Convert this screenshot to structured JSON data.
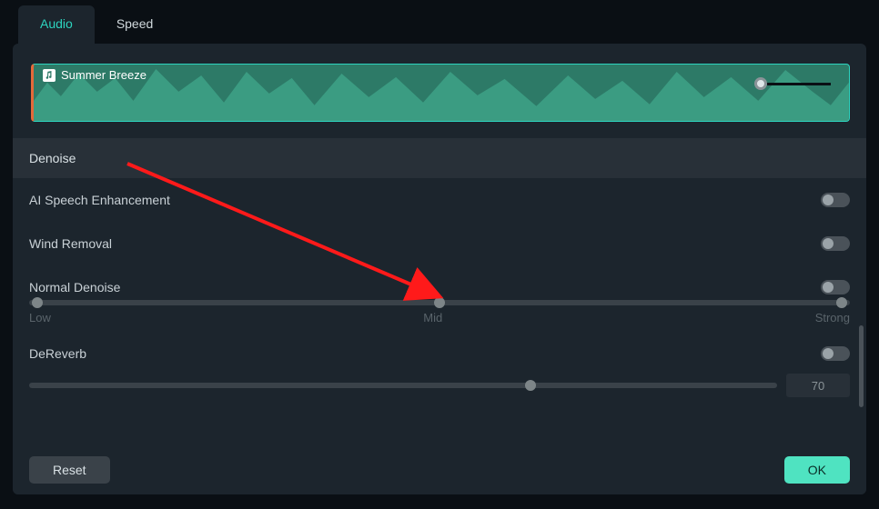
{
  "tabs": [
    {
      "label": "Audio",
      "active": true
    },
    {
      "label": "Speed",
      "active": false
    }
  ],
  "clip": {
    "title": "Summer Breeze",
    "icon": "music-note-icon"
  },
  "section": {
    "title": "Denoise"
  },
  "options": {
    "ai_speech": {
      "label": "AI Speech Enhancement",
      "enabled": false
    },
    "wind_removal": {
      "label": "Wind Removal",
      "enabled": false
    },
    "normal_denoise": {
      "label": "Normal Denoise",
      "enabled": false,
      "scale": [
        "Low",
        "Mid",
        "Strong"
      ]
    },
    "dereverb": {
      "label": "DeReverb",
      "enabled": false,
      "value": "70",
      "thumb_style": "left:67%"
    }
  },
  "footer": {
    "reset": "Reset",
    "ok": "OK"
  },
  "colors": {
    "accent": "#2dd4bf",
    "ok_button": "#4fe3c1",
    "panel": "#1c252d",
    "arrow": "#ff1a1a"
  }
}
